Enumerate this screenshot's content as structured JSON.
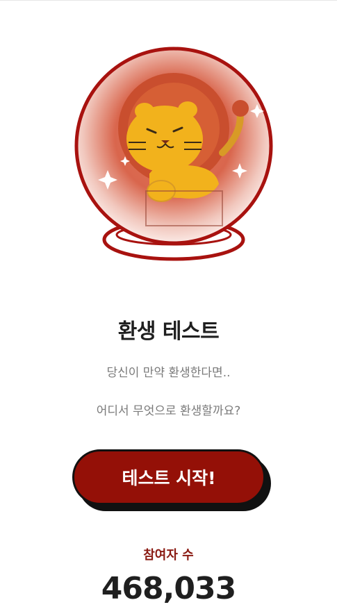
{
  "hero": {
    "icon": "lion-crystal-ball-illustration"
  },
  "title": "환생 테스트",
  "subtitle_lines": [
    "당신이 만약 환생한다면..",
    "어디서 무엇으로 환생할까요?"
  ],
  "start_button": {
    "label": "테스트 시작!"
  },
  "participants": {
    "label": "참여자 수",
    "count": "468,033"
  },
  "colors": {
    "accent": "#941007",
    "label_red": "#8a1a12",
    "title": "#1f1f1f",
    "subtitle": "#7a7a7a"
  }
}
